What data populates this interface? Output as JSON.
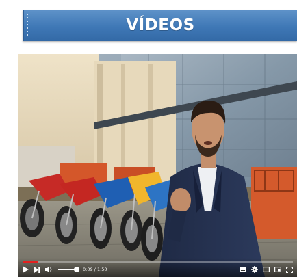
{
  "banner": {
    "title": "VÍDEOS"
  },
  "player": {
    "progress": 0.058,
    "volume": 1.0,
    "time_current": "0:09",
    "time_separator": " / ",
    "time_total": "1:50"
  },
  "colors": {
    "banner_blue": "#3f78b6",
    "progress_red": "#e32120"
  },
  "icons": {
    "play": "play-icon",
    "next": "next-icon",
    "volume": "volume-icon",
    "subtitles": "subtitles-icon",
    "settings": "gear-icon",
    "miniplayer": "miniplayer-icon",
    "theater": "theater-icon",
    "fullscreen": "fullscreen-icon"
  }
}
